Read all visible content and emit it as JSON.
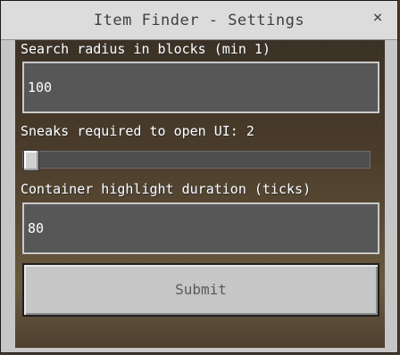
{
  "window": {
    "title": "Item Finder - Settings",
    "close_glyph": "×"
  },
  "form": {
    "search_radius": {
      "label": "Search radius in blocks (min 1)",
      "value": "100"
    },
    "sneaks_required": {
      "label": "Sneaks required to open UI: 2",
      "value": 2,
      "min": 2,
      "max": 20
    },
    "highlight_duration": {
      "label": "Container highlight duration (ticks)",
      "value": "80"
    },
    "submit_label": "Submit"
  },
  "colors": {
    "dialog_bg": "#c6c6c6",
    "field_bg": "#575757",
    "label_text": "#ffffff"
  },
  "icons": {
    "close": "close-icon"
  }
}
